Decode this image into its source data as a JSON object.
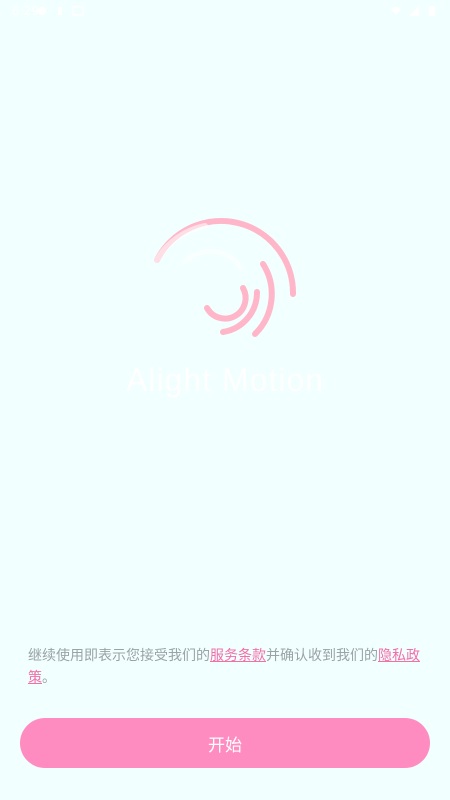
{
  "status_bar": {
    "time": "6:29",
    "icons_left": [
      "notification-icon",
      "info-icon",
      "gallery-icon"
    ],
    "icons_right": [
      "wifi-icon",
      "signal-icon",
      "battery-icon"
    ]
  },
  "logo": {
    "icon": "alight-motion-swirl-icon",
    "wordmark": "Alight Motion",
    "colors": {
      "arc": "#FFB6C8",
      "wordmark": "#FFFFFF"
    }
  },
  "terms": {
    "prefix": "继续使用即表示您接受我们的",
    "terms_link": "服务条款",
    "middle": "并确认收到我们的",
    "privacy_link": "隐私政策",
    "suffix": "。"
  },
  "start_button": {
    "label": "开始"
  },
  "colors": {
    "background": "#F1FFFF",
    "accent": "#FF8CC0",
    "link": "#F26FA8",
    "text_muted": "#9AA3A6"
  }
}
